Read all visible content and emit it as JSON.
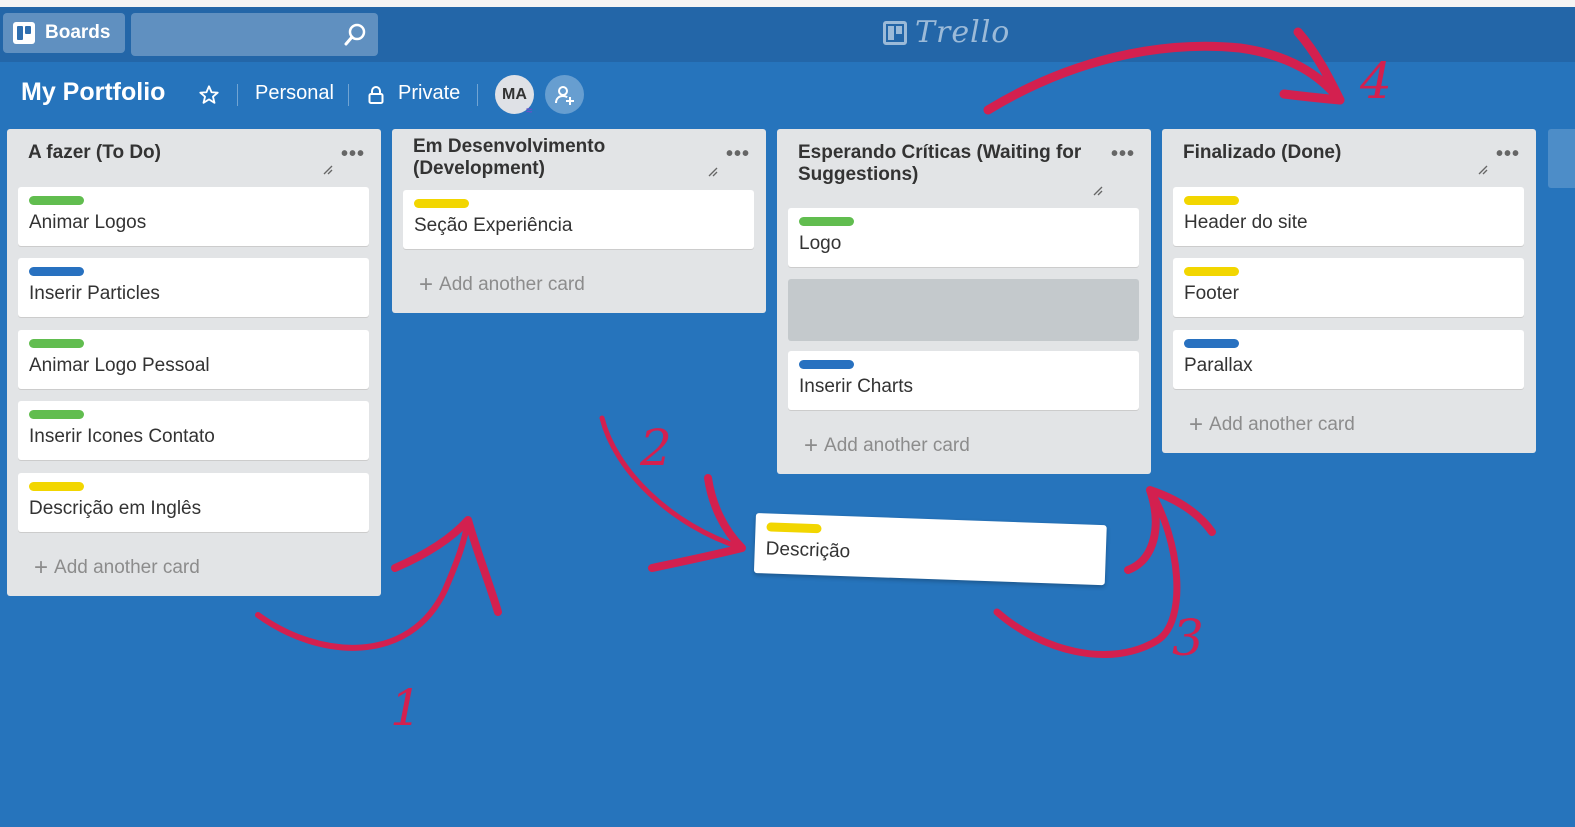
{
  "header": {
    "boards_label": "Boards",
    "logo_text": "Trello"
  },
  "board": {
    "title": "My Portfolio",
    "team": "Personal",
    "visibility": "Private",
    "member_initials": "MA"
  },
  "colors": {
    "green": "#61bd4f",
    "blue": "#2871c0",
    "yellow": "#f2d600",
    "annotation": "#d3204f"
  },
  "lists": [
    {
      "title": "A fazer (To Do)",
      "cards": [
        {
          "label_color": "green",
          "title": "Animar Logos"
        },
        {
          "label_color": "blue",
          "title": "Inserir Particles"
        },
        {
          "label_color": "green",
          "title": "Animar Logo Pessoal"
        },
        {
          "label_color": "green",
          "title": "Inserir Icones Contato"
        },
        {
          "label_color": "yellow",
          "title": "Descrição em Inglês"
        }
      ],
      "add_label": "Add another card"
    },
    {
      "title": "Em Desenvolvimento (Development)",
      "cards": [
        {
          "label_color": "yellow",
          "title": "Seção Experiência"
        }
      ],
      "add_label": "Add another card"
    },
    {
      "title": "Esperando Críticas (Waiting for Suggestions)",
      "cards": [
        {
          "label_color": "green",
          "title": "Logo"
        },
        {
          "label_color": "blue",
          "title": "Inserir Charts"
        }
      ],
      "add_label": "Add another card"
    },
    {
      "title": "Finalizado (Done)",
      "cards": [
        {
          "label_color": "yellow",
          "title": "Header do site"
        },
        {
          "label_color": "yellow",
          "title": "Footer"
        },
        {
          "label_color": "blue",
          "title": "Parallax"
        }
      ],
      "add_label": "Add another card"
    }
  ],
  "dragged_card": {
    "label_color": "yellow",
    "title": "Descrição"
  },
  "annotations": [
    "1",
    "2",
    "3",
    "4"
  ]
}
